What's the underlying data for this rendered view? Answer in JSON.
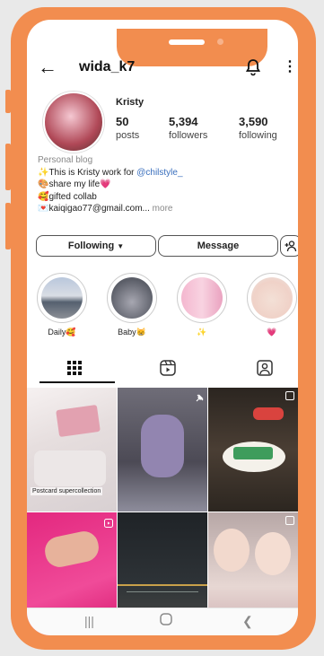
{
  "profile": {
    "username": "wida_k7",
    "display_name": "Kristy",
    "stats": [
      {
        "value": "50",
        "label": "posts"
      },
      {
        "value": "5,394",
        "label": "followers"
      },
      {
        "value": "3,590",
        "label": "following"
      }
    ],
    "bio": {
      "category": "Personal blog",
      "line1_text": "✨This is Kristy work for ",
      "line1_tag": "@chilstyle_",
      "line2": "🎨share my life💗",
      "line3": "🥰gifted collab",
      "line4": "💌kaiqigao77@gmail.com...",
      "more": "more"
    }
  },
  "actions": {
    "following": "Following",
    "message": "Message"
  },
  "highlights": [
    {
      "label": "Daily🥰"
    },
    {
      "label": "Baby😸"
    },
    {
      "label": "✨"
    },
    {
      "label": "💗"
    }
  ],
  "posts": {
    "caption_first": "Postcard supercollection"
  },
  "icons": {
    "back": "back-arrow-icon",
    "bell": "bell-icon",
    "more": "more-vertical-icon",
    "add_person": "add-person-icon",
    "grid": "grid-icon",
    "reels": "reels-icon",
    "tagged": "tagged-icon",
    "nav_recent": "recent-apps-icon",
    "nav_home": "home-icon",
    "nav_back": "nav-back-icon"
  },
  "colors": {
    "frame": "#f28d4f",
    "link": "#3a6fbd"
  }
}
